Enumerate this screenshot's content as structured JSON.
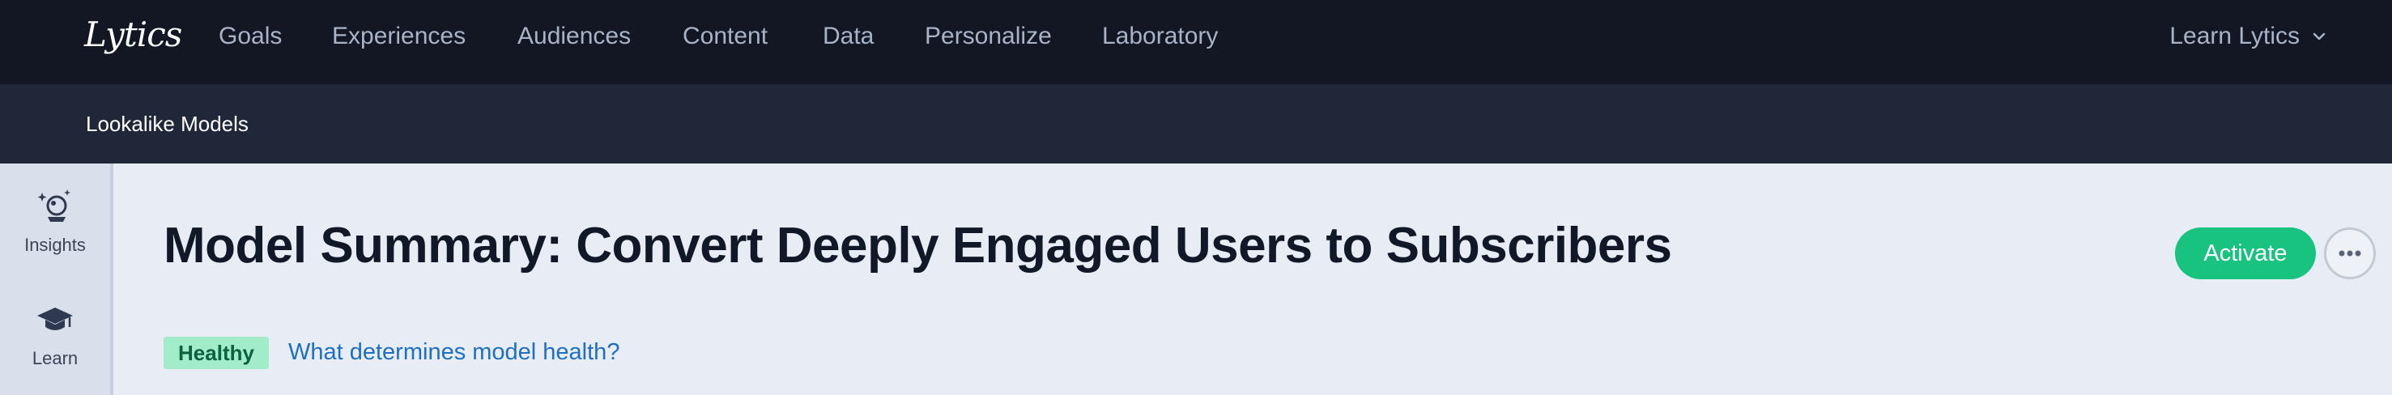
{
  "brand": {
    "logo_text": "Lytics"
  },
  "nav": {
    "items": [
      {
        "label": "Goals"
      },
      {
        "label": "Experiences"
      },
      {
        "label": "Audiences"
      },
      {
        "label": "Content"
      },
      {
        "label": "Data"
      },
      {
        "label": "Personalize"
      },
      {
        "label": "Laboratory"
      }
    ],
    "account_label": "Learn Lytics"
  },
  "subnav": {
    "title": "Lookalike Models"
  },
  "sidebar": {
    "items": [
      {
        "label": "Insights",
        "icon": "crystal-ball-icon"
      },
      {
        "label": "Learn",
        "icon": "graduation-cap-icon"
      }
    ]
  },
  "main": {
    "title": "Model Summary: Convert Deeply Engaged Users to Subscribers",
    "activate_label": "Activate",
    "more_icon": "ellipsis-icon",
    "health_badge": "Healthy",
    "health_link": "What determines model health?"
  },
  "colors": {
    "topnav_bg": "#121723",
    "subnav_bg": "#1f2738",
    "page_bg": "#e8edf5",
    "activate": "#18c27f",
    "badge_bg": "#a3ecca",
    "link": "#1f6fc0"
  }
}
